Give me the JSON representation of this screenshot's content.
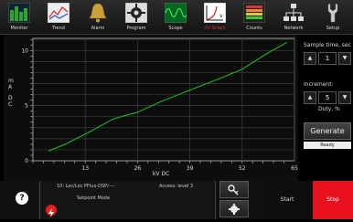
{
  "toolbar": {
    "items": [
      {
        "label": "Monitor",
        "icon": "monitor-icon"
      },
      {
        "label": "Trend",
        "icon": "trend-icon"
      },
      {
        "label": "Alarm",
        "icon": "bell-icon"
      },
      {
        "label": "Program",
        "icon": "program-icon"
      },
      {
        "label": "Scope",
        "icon": "scope-icon"
      },
      {
        "label": "I/V Graph",
        "icon": "iv-graph-icon"
      },
      {
        "label": "Counts",
        "icon": "counts-icon"
      },
      {
        "label": "Network",
        "icon": "network-icon"
      },
      {
        "label": "Setup",
        "icon": "wrench-icon"
      }
    ],
    "active_index": 5,
    "active_color": "#e23030"
  },
  "plot": {
    "y_axis_label": "m A D C",
    "x_axis_label": "kV DC",
    "line_color": "#1fc41f"
  },
  "chart_data": {
    "type": "line",
    "xlabel": "kV DC",
    "ylabel": "mA DC",
    "x_ticks": [
      "13",
      "26",
      "39",
      "52",
      "65"
    ],
    "y_ticks": [
      "10",
      "5",
      "0"
    ],
    "xlim": [
      0,
      65
    ],
    "ylim": [
      0,
      11.1
    ],
    "grid": true,
    "series": [
      {
        "x": [
          4,
          8,
          14,
          20,
          26,
          32,
          39,
          46,
          52,
          58,
          63
        ],
        "y": [
          0.9,
          1.5,
          2.6,
          3.8,
          4.4,
          5.4,
          6.4,
          7.4,
          8.3,
          9.7,
          10.7
        ]
      }
    ]
  },
  "right_panel": {
    "sample_time_label": "Sample time, sec",
    "sample_time_value": "1",
    "increment_label": "Increment:",
    "increment_value": "5",
    "increment_unit": "Duty, %",
    "generate_label": "Generate",
    "status": "Ready",
    "spin_up": "▲",
    "spin_down": "▼"
  },
  "bottom": {
    "help_label": "?",
    "device": "10: Loc/Loc PFlux-DSP/----",
    "access": "Access: level 3",
    "mode": "Setpoint Mode",
    "start_label": "Start",
    "stop_label": "Stop",
    "stop_color": "#e8101c"
  }
}
